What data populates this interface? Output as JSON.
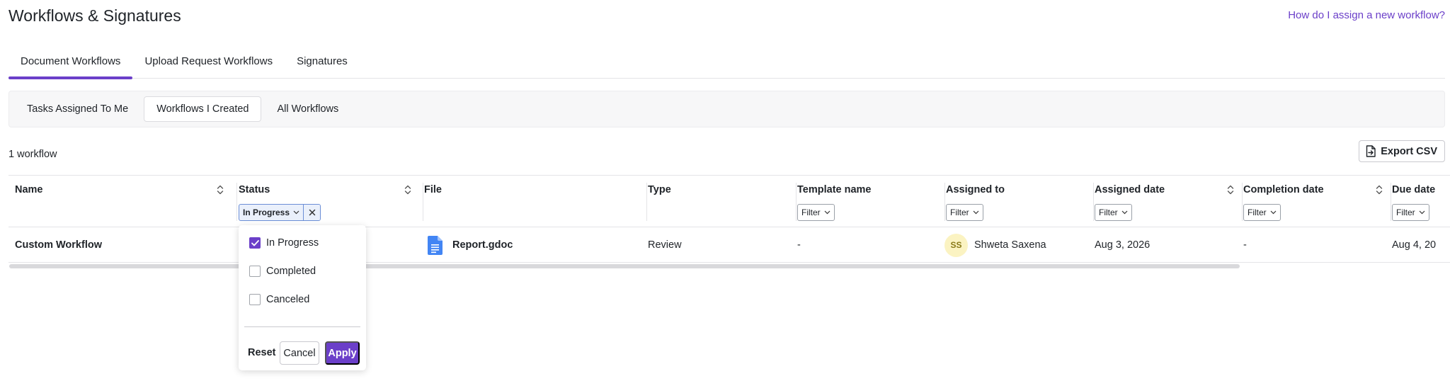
{
  "page": {
    "title": "Workflows & Signatures",
    "help_link": "How do I assign a new workflow?"
  },
  "main_tabs": [
    {
      "label": "Document Workflows",
      "active": true
    },
    {
      "label": "Upload Request Workflows",
      "active": false
    },
    {
      "label": "Signatures",
      "active": false
    }
  ],
  "sub_tabs": [
    {
      "label": "Tasks Assigned To Me",
      "active": false
    },
    {
      "label": "Workflows I Created",
      "active": true
    },
    {
      "label": "All Workflows",
      "active": false
    }
  ],
  "count_label": "1 workflow",
  "export_label": "Export CSV",
  "filter_label": "Filter",
  "columns": {
    "name": "Name",
    "status": "Status",
    "file": "File",
    "type": "Type",
    "template": "Template name",
    "assigned_to": "Assigned to",
    "assigned_date": "Assigned date",
    "completion_date": "Completion date",
    "due_date": "Due date"
  },
  "status_chip": "In Progress",
  "rows": [
    {
      "name": "Custom Workflow",
      "file": "Report.gdoc",
      "type": "Review",
      "template": "-",
      "assignee_initials": "SS",
      "assignee": "Shweta Saxena",
      "assigned_date": "Aug 3, 2026",
      "completion_date": "-",
      "due_date": "Aug 4, 20"
    }
  ],
  "status_dropdown": {
    "options": [
      {
        "label": "In Progress",
        "checked": true
      },
      {
        "label": "Completed",
        "checked": false
      },
      {
        "label": "Canceled",
        "checked": false
      }
    ],
    "reset": "Reset",
    "cancel": "Cancel",
    "apply": "Apply"
  },
  "colors": {
    "accent": "#6b3fc9",
    "chip_bg": "#eaf0fb",
    "chip_border": "#6b8ed6",
    "avatar_bg": "#fbf3c2",
    "file_icon": "#4285f4"
  },
  "icons": {
    "sort": "sort-updown-icon",
    "chevron": "chevron-down-icon",
    "close": "close-icon",
    "export": "export-file-icon",
    "file": "google-doc-icon",
    "check": "checkmark-icon"
  }
}
